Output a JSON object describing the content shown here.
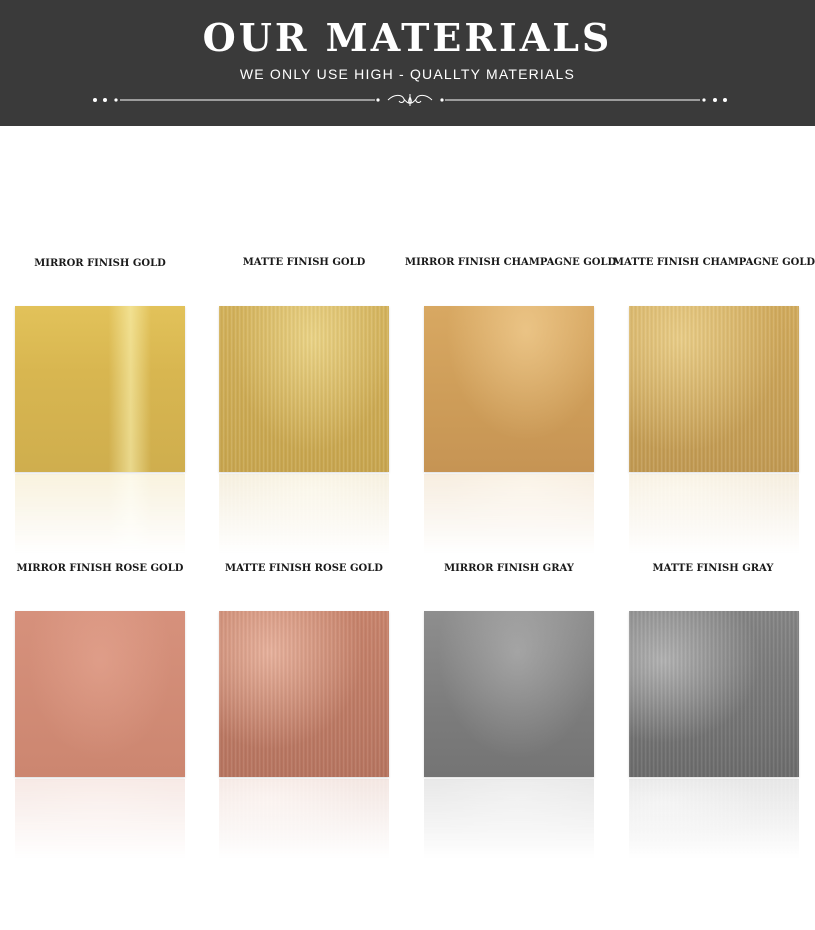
{
  "banner": {
    "title": "OUR MATERIALS",
    "subtitle": "WE ONLY USE HIGH - QUALLTY MATERIALS",
    "background_color": "#3a3a3a"
  },
  "materials": [
    {
      "label": "MIRROR FINISH GOLD",
      "color": "#d8b650"
    },
    {
      "label": "MATTE FINISH GOLD",
      "color": "#c9a64e"
    },
    {
      "label": "MIRROR FINISH CHAMPAGNE GOLD",
      "color": "#cd9c58"
    },
    {
      "label": "MATTE FINISH CHAMPAGNE GOLD",
      "color": "#c29a52"
    },
    {
      "label": "MIRROR FINISH ROSE GOLD",
      "color": "#cc8670"
    },
    {
      "label": "MATTE FINISH ROSE GOLD",
      "color": "#b87560"
    },
    {
      "label": "MIRROR FINISH GRAY",
      "color": "#7c7c7c"
    },
    {
      "label": "MATTE FINISH GRAY",
      "color": "#6c6c6c"
    }
  ]
}
